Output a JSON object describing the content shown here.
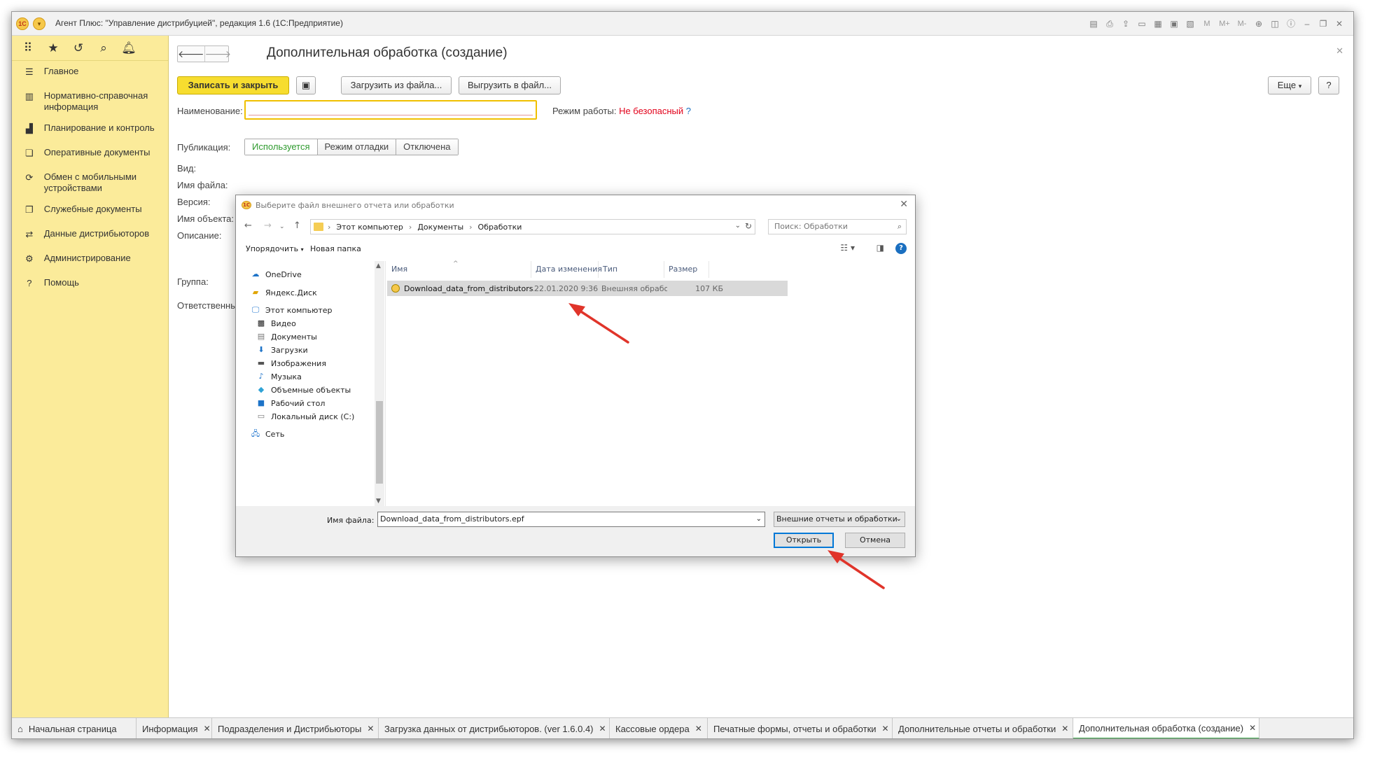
{
  "window": {
    "title": "Агент Плюс: \"Управление дистрибуцией\", редакция 1.6  (1С:Предприятие)",
    "logo_text": "1С",
    "menu_icon": "chevron-down-icon",
    "toolbar_icons": [
      "save-icon",
      "print-icon",
      "upload-icon",
      "doc-icon",
      "table-icon",
      "calendar-icon",
      "calc-icon"
    ],
    "mem_buttons": [
      "M",
      "M+",
      "M-"
    ]
  },
  "sidebar": {
    "top_icons": [
      "apps-icon",
      "star-icon",
      "history-icon",
      "search-icon",
      "bell-icon"
    ],
    "items": [
      {
        "label": "Главное",
        "icon": "menu-icon"
      },
      {
        "label": "Нормативно-справочная информация",
        "icon": "catalog-icon"
      },
      {
        "label": "Планирование и контроль",
        "icon": "chart-icon"
      },
      {
        "label": "Оперативные документы",
        "icon": "documents-icon"
      },
      {
        "label": "Обмен с мобильными устройствами",
        "icon": "sync-icon"
      },
      {
        "label": "Служебные документы",
        "icon": "service-doc-icon"
      },
      {
        "label": "Данные дистрибьюторов",
        "icon": "distributors-icon"
      },
      {
        "label": "Администрирование",
        "icon": "gear-icon"
      },
      {
        "label": "Помощь",
        "icon": "help-icon"
      }
    ]
  },
  "form": {
    "title": "Дополнительная обработка (создание)",
    "save_close": "Записать и закрыть",
    "load_file": "Загрузить из файла...",
    "export_file": "Выгрузить в файл...",
    "more": "Еще",
    "help": "?",
    "name_label": "Наименование:",
    "mode_label": "Режим работы:",
    "mode_value": "Не безопасный",
    "mode_help": "?",
    "publication_label": "Публикация:",
    "publication_options": [
      "Используется",
      "Режим отладки",
      "Отключена"
    ],
    "kind_label": "Вид:",
    "file_label": "Имя файла:",
    "version_label": "Версия:",
    "object_label": "Имя объекта:",
    "description_label": "Описание:",
    "group_label": "Группа:",
    "responsible_label": "Ответственный"
  },
  "dialog": {
    "title": "Выберите файл внешнего отчета или обработки",
    "breadcrumb": [
      "Этот компьютер",
      "Документы",
      "Обработки"
    ],
    "search_placeholder": "Поиск: Обработки",
    "organize": "Упорядочить",
    "new_folder": "Новая папка",
    "nav": [
      {
        "label": "OneDrive",
        "icon": "cloud-icon"
      },
      {
        "label": "Яндекс.Диск",
        "icon": "yandex-disk-icon"
      },
      {
        "label": "Этот компьютер",
        "icon": "computer-icon"
      },
      {
        "label": "Видео",
        "icon": "video-icon"
      },
      {
        "label": "Документы",
        "icon": "document-icon"
      },
      {
        "label": "Загрузки",
        "icon": "download-icon"
      },
      {
        "label": "Изображения",
        "icon": "image-icon"
      },
      {
        "label": "Музыка",
        "icon": "music-icon"
      },
      {
        "label": "Объемные объекты",
        "icon": "cube-icon"
      },
      {
        "label": "Рабочий стол",
        "icon": "desktop-icon"
      },
      {
        "label": "Локальный диск (C:)",
        "icon": "disk-icon"
      },
      {
        "label": "Сеть",
        "icon": "network-icon"
      }
    ],
    "columns": [
      "Имя",
      "Дата изменения",
      "Тип",
      "Размер"
    ],
    "files": [
      {
        "name": "Download_data_from_distributors.epf",
        "date": "22.01.2020 9:36",
        "type": "Внешняя обрабо...",
        "size": "107 КБ"
      }
    ],
    "filename_label": "Имя файла:",
    "filename_value": "Download_data_from_distributors.epf",
    "filetype": "Внешние отчеты и обработки",
    "open": "Открыть",
    "cancel": "Отмена"
  },
  "tabs": [
    {
      "label": "Начальная страница",
      "icon": "home-icon"
    },
    {
      "label": "Информация"
    },
    {
      "label": "Подразделения и Дистрибьюторы"
    },
    {
      "label": "Загрузка данных от дистрибьюторов. (ver 1.6.0.4)"
    },
    {
      "label": "Кассовые ордера"
    },
    {
      "label": "Печатные формы, отчеты и обработки"
    },
    {
      "label": "Дополнительные отчеты и обработки"
    },
    {
      "label": "Дополнительная обработка (создание)",
      "active": true
    }
  ],
  "colors": {
    "accent_yellow": "#f7dd2f",
    "sidebar": "#fbeb9a",
    "warning_red": "#e2001a",
    "active_green": "#2e9a2e",
    "annotation_arrow": "#e0342a"
  }
}
